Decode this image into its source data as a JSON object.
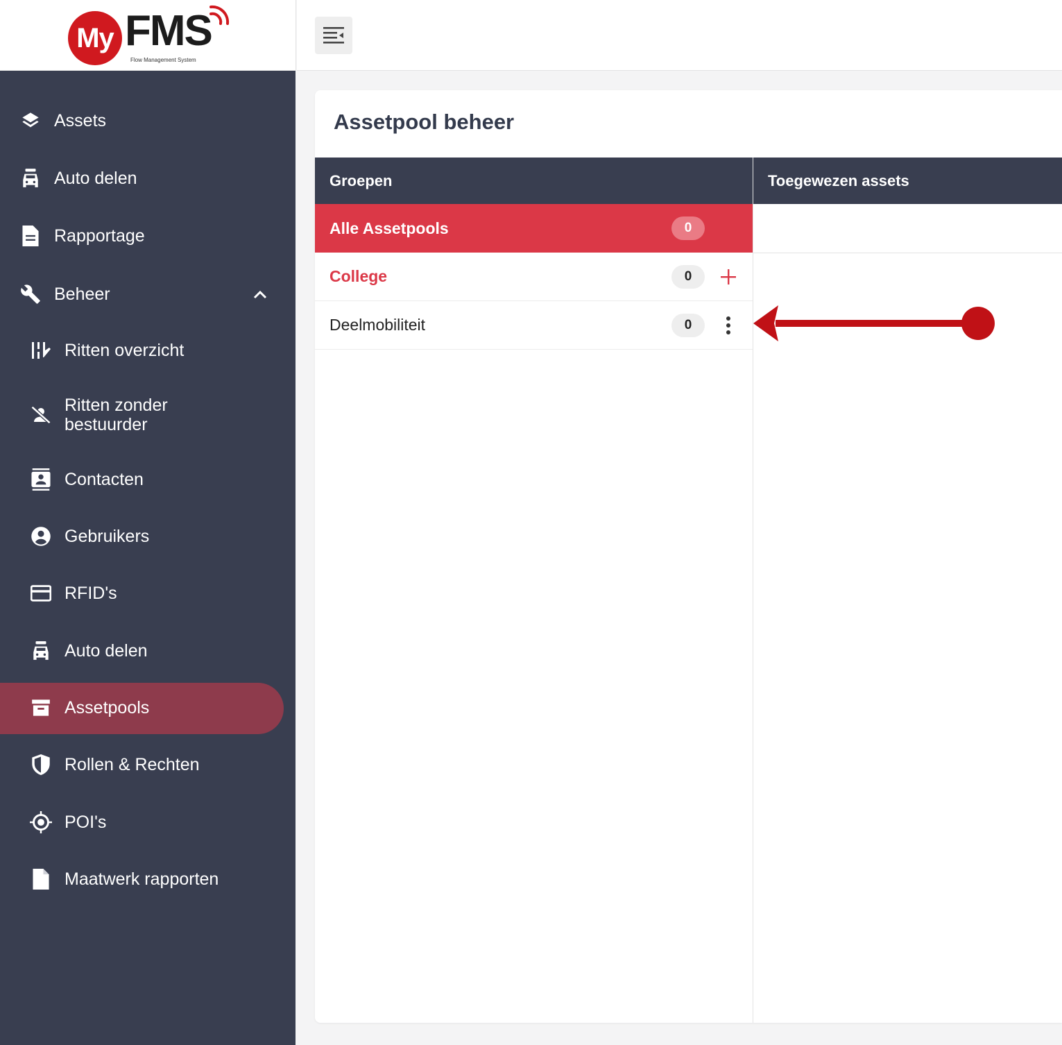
{
  "logo": {
    "brand_prefix": "My",
    "brand_name": "FMS",
    "tagline": "Flow Management System",
    "brand_color": "#d0191f"
  },
  "header": {
    "menu_toggle_icon": "menu-collapse-icon"
  },
  "sidebar": {
    "background": "#393e50",
    "active_color": "#8e3b4c",
    "items": [
      {
        "label": "Assets",
        "icon": "layers-icon"
      },
      {
        "label": "Auto delen",
        "icon": "car-icon"
      },
      {
        "label": "Rapportage",
        "icon": "document-icon"
      },
      {
        "label": "Beheer",
        "icon": "wrench-icon",
        "expanded": true
      },
      {
        "label": "Ritten overzicht",
        "icon": "trips-icon"
      },
      {
        "label": "Ritten zonder bestuurder",
        "icon": "no-driver-icon"
      },
      {
        "label": "Contacten",
        "icon": "contacts-icon"
      },
      {
        "label": "Gebruikers",
        "icon": "user-circle-icon"
      },
      {
        "label": "RFID's",
        "icon": "card-icon"
      },
      {
        "label": "Auto delen",
        "icon": "car-icon"
      },
      {
        "label": "Assetpools",
        "icon": "archive-icon",
        "active": true
      },
      {
        "label": "Rollen & Rechten",
        "icon": "shield-icon"
      },
      {
        "label": "POI's",
        "icon": "target-icon"
      },
      {
        "label": "Maatwerk rapporten",
        "icon": "file-icon"
      }
    ]
  },
  "main": {
    "title": "Assetpool beheer",
    "columns": {
      "groups": "Groepen",
      "assigned": "Toegewezen assets"
    },
    "groups": [
      {
        "name": "Alle Assetpools",
        "count": "0",
        "state": "selected"
      },
      {
        "name": "College",
        "count": "0",
        "action": "add-icon"
      },
      {
        "name": "Deelmobiliteit",
        "count": "0",
        "action": "more-vertical-icon"
      }
    ],
    "accent_color": "#db3847",
    "header_color": "#393e50"
  },
  "annotation": {
    "arrow_color": "#c01116"
  }
}
